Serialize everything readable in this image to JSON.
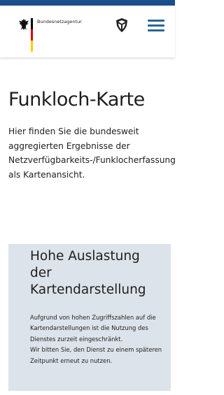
{
  "header": {
    "org_name": "Bundesnetzagentur",
    "accent_color": "#1b4f8c",
    "icons": [
      "federal-eagle-icon",
      "shield-icon",
      "hamburger-menu-icon"
    ]
  },
  "page": {
    "title": "Funkloch-Karte",
    "intro": "Hier finden Sie die bundesweit aggregierten Ergebnisse der Netzverfügbarkeits-/Funklocherfassung als Kartenansicht."
  },
  "notice": {
    "title": "Hohe Auslastung der Kartendarstellung",
    "paragraph1": "Aufgrund von hohen Zugriffszahlen auf die Kartendarstellungen ist die Nutzung des Dienstes zurzeit eingeschränkt.",
    "paragraph2": "Wir bitten Sie, den Dienst zu einem späteren Zeitpunkt erneut zu nutzen.",
    "background": "#dde3ea"
  }
}
